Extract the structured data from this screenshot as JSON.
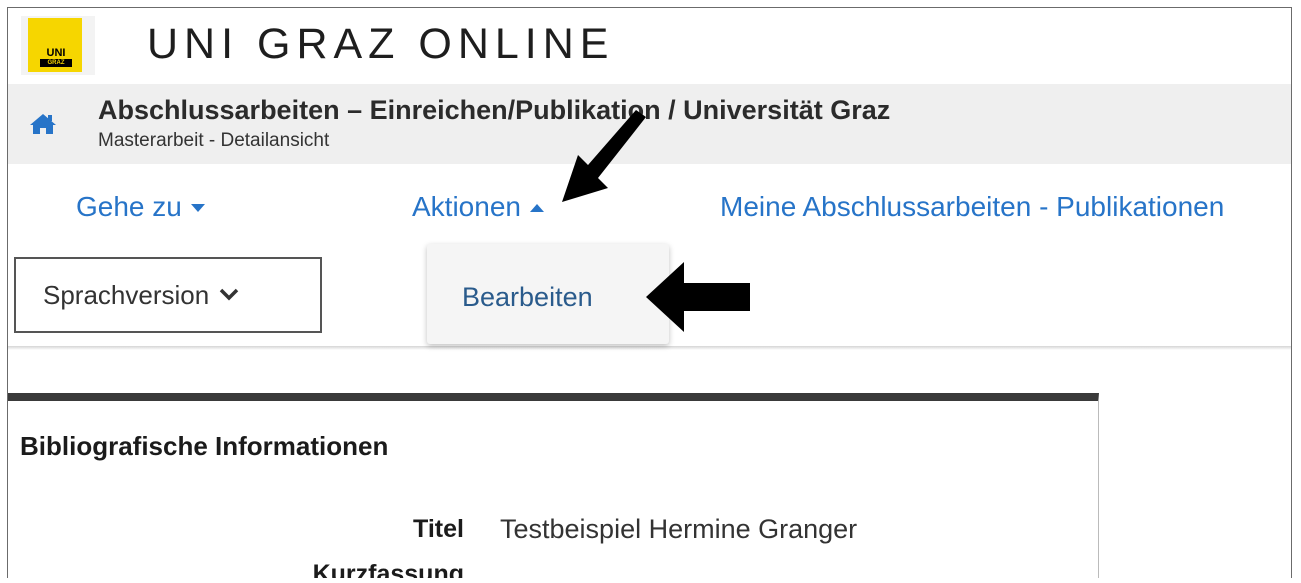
{
  "header": {
    "app_title": "UNI GRAZ ONLINE",
    "logo_text_top": "UNI",
    "logo_text_bottom": "GRAZ"
  },
  "breadcrumb": {
    "title": "Abschlussarbeiten – Einreichen/Publikation  / Universität Graz",
    "subtitle": "Masterarbeit - Detailansicht",
    "icon": "home-icon"
  },
  "nav": {
    "goto_label": "Gehe zu",
    "actions_label": "Aktionen",
    "my_theses_label": "Meine Abschlussarbeiten - Publikationen"
  },
  "language_button": {
    "label": "Sprachversion"
  },
  "actions_menu": {
    "items": [
      {
        "label": "Bearbeiten"
      }
    ]
  },
  "card": {
    "title": "Bibliografische Informationen",
    "fields": [
      {
        "label": "Titel",
        "value": "Testbeispiel Hermine Granger"
      },
      {
        "label": "Kurzfassung",
        "value": ""
      }
    ]
  },
  "colors": {
    "link": "#2774c8",
    "logo_yellow": "#f6d600",
    "crumb_bg": "#efefef",
    "card_border": "#3a3a3a"
  }
}
